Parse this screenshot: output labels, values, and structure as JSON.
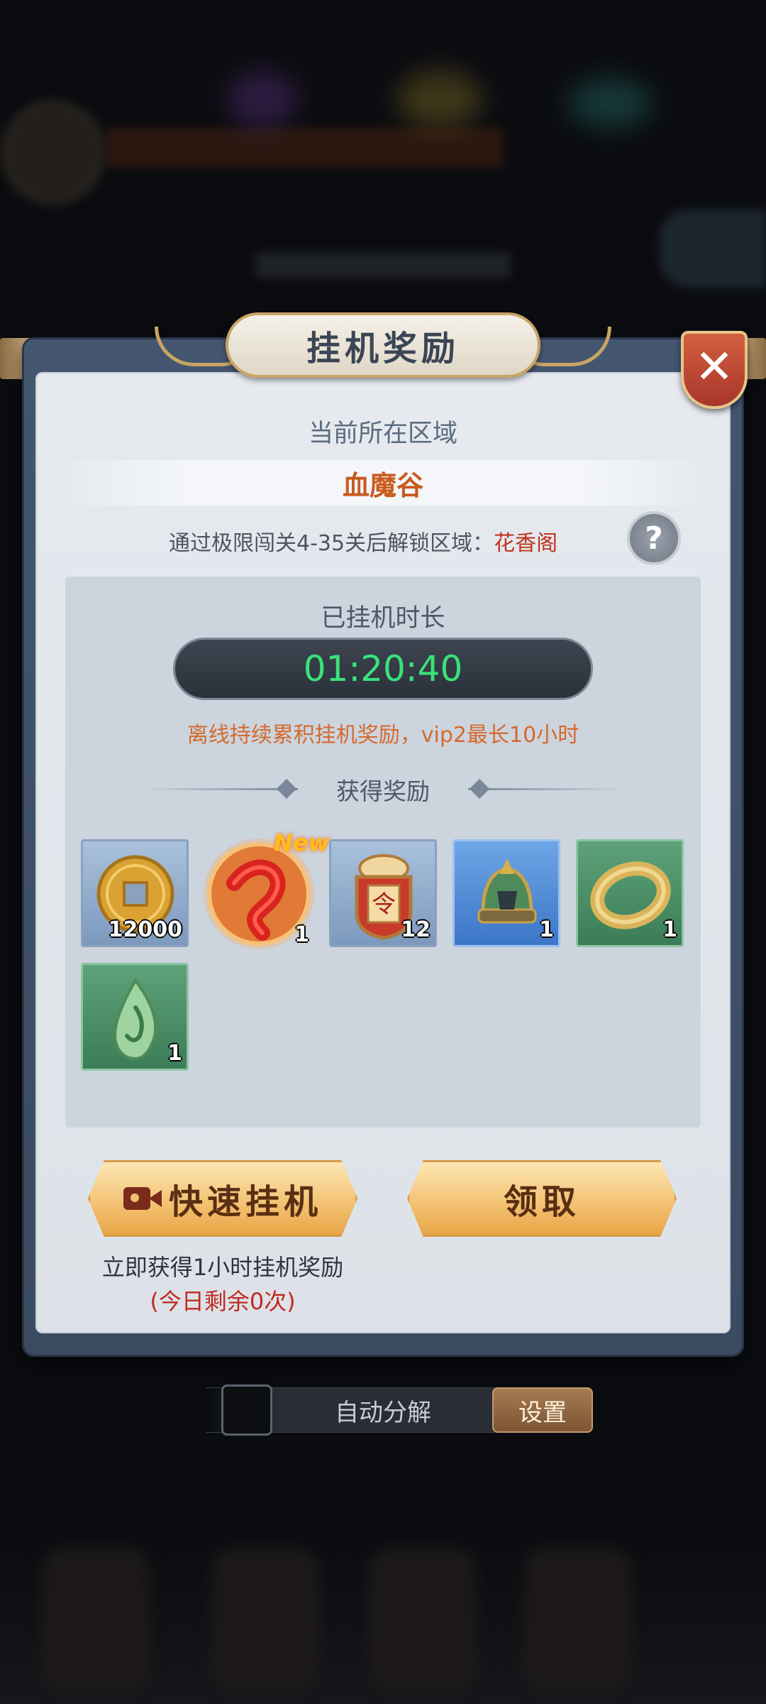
{
  "dialog": {
    "title": "挂机奖励",
    "current_region_label": "当前所在区域",
    "current_region_name": "血魔谷",
    "unlock_prefix": "通过极限闯关4-35关后解锁区域：",
    "unlock_region": "花香阁",
    "help_symbol": "?",
    "close_symbol": "✕"
  },
  "idle": {
    "label": "已挂机时长",
    "time": "01:20:40",
    "note": "离线持续累积挂机奖励，vip2最长10小时"
  },
  "rewards": {
    "header": "获得奖励",
    "new_badge": "New",
    "items": [
      {
        "icon": "copper-coin-icon",
        "count": "12000",
        "rarity": "blue"
      },
      {
        "icon": "red-sash-icon",
        "count": "1",
        "rarity": "orange"
      },
      {
        "icon": "command-token-icon",
        "count": "12",
        "rarity": "blue"
      },
      {
        "icon": "helmet-icon",
        "count": "1",
        "rarity": "brightblue"
      },
      {
        "icon": "jade-ring-icon",
        "count": "1",
        "rarity": "green"
      },
      {
        "icon": "jade-pendant-icon",
        "count": "1",
        "rarity": "green"
      }
    ]
  },
  "buttons": {
    "quick_idle": "快速挂机",
    "claim": "领取",
    "quick_desc": "立即获得1小时挂机奖励",
    "quick_remain": "(今日剩余0次)"
  },
  "footer": {
    "auto_decompose": "自动分解",
    "settings": "设置"
  },
  "colors": {
    "timer_green": "#38e27a",
    "region_orange": "#c85a1e",
    "warning_red": "#c02a22",
    "button_gold": "#f3c070"
  }
}
